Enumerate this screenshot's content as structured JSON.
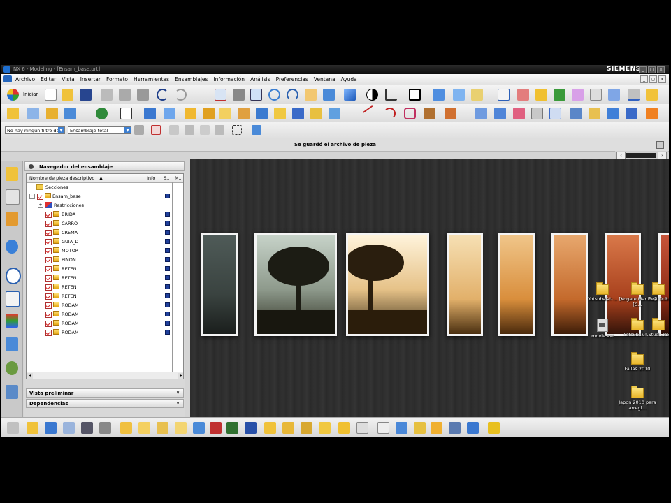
{
  "window": {
    "title": "NX 6 - Modeling - [Ensam_base.prt]",
    "brand": "SIEMENS",
    "controls": [
      "_",
      "□",
      "×"
    ]
  },
  "menubar": {
    "items": [
      "Archivo",
      "Editar",
      "Vista",
      "Insertar",
      "Formato",
      "Herramientas",
      "Ensamblajes",
      "Información",
      "Análisis",
      "Preferencias",
      "Ventana",
      "Ayuda"
    ]
  },
  "toolbar": {
    "start_label": "Iniciar",
    "accent": "#2466bd"
  },
  "selection_bar": {
    "filter_value": "No hay ningún filtro de",
    "scope_value": "Ensamblaje total"
  },
  "status": {
    "message": "Se guardó el archivo de pieza"
  },
  "navigator": {
    "title": "Navegador del ensamblaje",
    "columns": {
      "name": "Nombre de pieza descriptivo",
      "info": "Info",
      "s": "S..",
      "m": "M.."
    },
    "rows": [
      {
        "label": "Secciones",
        "type": "folder",
        "level": 0,
        "checked": false,
        "saved": false
      },
      {
        "label": "Ensam_base",
        "type": "assembly",
        "level": 0,
        "checked": true,
        "saved": true
      },
      {
        "label": "Restricciones",
        "type": "constraints",
        "level": 1,
        "checked": false,
        "saved": false
      },
      {
        "label": "BRIDA",
        "type": "part",
        "level": 1,
        "checked": true,
        "saved": true
      },
      {
        "label": "CARRO",
        "type": "part",
        "level": 1,
        "checked": true,
        "saved": true
      },
      {
        "label": "CREMA",
        "type": "part",
        "level": 1,
        "checked": true,
        "saved": true
      },
      {
        "label": "GUIA_D",
        "type": "part",
        "level": 1,
        "checked": true,
        "saved": true
      },
      {
        "label": "MOTOR",
        "type": "part",
        "level": 1,
        "checked": true,
        "saved": true
      },
      {
        "label": "PINON",
        "type": "part",
        "level": 1,
        "checked": true,
        "saved": true
      },
      {
        "label": "RETEN",
        "type": "part",
        "level": 1,
        "checked": true,
        "saved": true
      },
      {
        "label": "RETEN",
        "type": "part",
        "level": 1,
        "checked": true,
        "saved": true
      },
      {
        "label": "RETEN",
        "type": "part",
        "level": 1,
        "checked": true,
        "saved": true
      },
      {
        "label": "RETEN",
        "type": "part",
        "level": 1,
        "checked": true,
        "saved": true
      },
      {
        "label": "RODAM",
        "type": "part",
        "level": 1,
        "checked": true,
        "saved": true
      },
      {
        "label": "RODAM",
        "type": "part",
        "level": 1,
        "checked": true,
        "saved": true
      },
      {
        "label": "RODAM",
        "type": "part",
        "level": 1,
        "checked": true,
        "saved": true
      },
      {
        "label": "RODAM",
        "type": "part",
        "level": 1,
        "checked": true,
        "saved": true
      }
    ],
    "panes": [
      "Vista preliminar",
      "Dependencias"
    ]
  },
  "desktop": {
    "icons": [
      {
        "label": "Yotsuba&!-...",
        "kind": "folder"
      },
      {
        "label": "[Kogare Maniko] [C...",
        "kind": "folder"
      },
      {
        "label": "Fest Dub",
        "kind": "folder"
      },
      {
        "label": "movie.avi",
        "kind": "file"
      },
      {
        "label": "Yotsuba&!...",
        "kind": "folder"
      },
      {
        "label": "Stud - Po",
        "kind": "folder"
      },
      {
        "label": "Fallas 2010",
        "kind": "folder"
      },
      {
        "label": "Japon 2010 para arregl...",
        "kind": "folder"
      }
    ]
  }
}
